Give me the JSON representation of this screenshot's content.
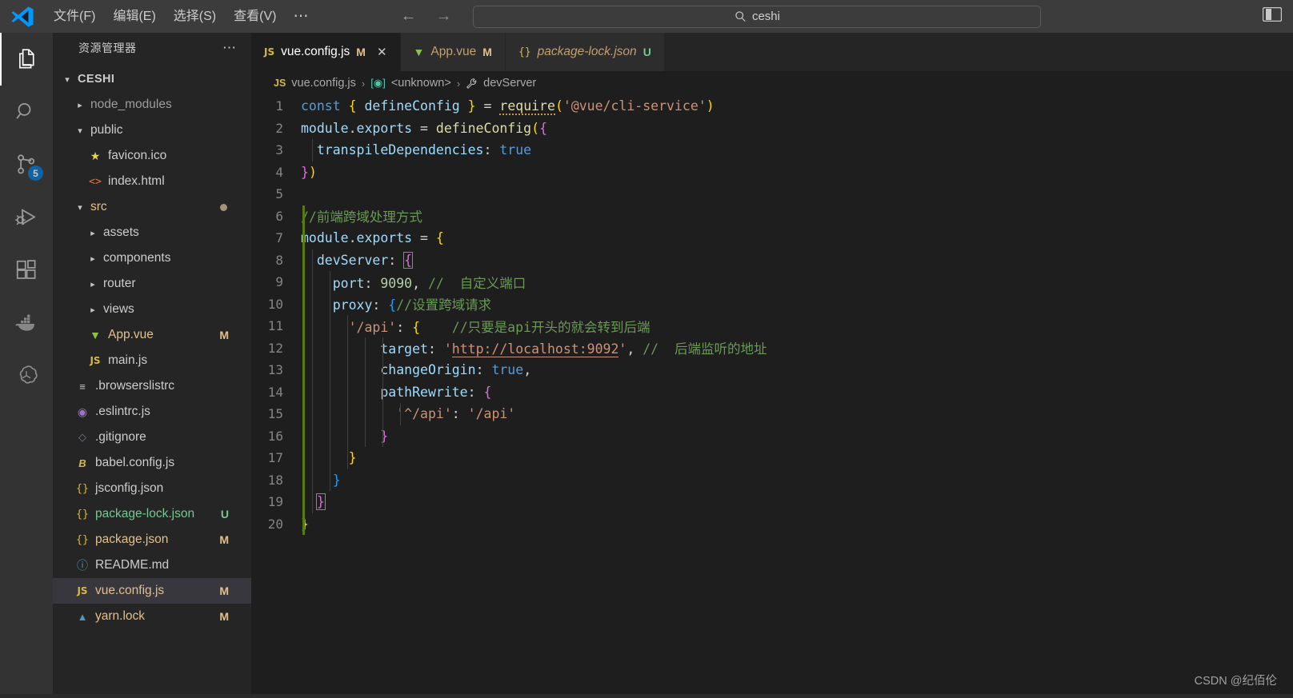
{
  "titlebar": {
    "logo_icon": "vscode-logo",
    "menus": [
      "文件(F)",
      "编辑(E)",
      "选择(S)",
      "查看(V)"
    ],
    "more_label": "⋯",
    "nav_back_icon": "arrow-left-icon",
    "nav_forward_icon": "arrow-right-icon",
    "search_icon": "search-icon",
    "search_value": "ceshi",
    "layout_icon": "toggle-panel-icon"
  },
  "activitybar": {
    "items": [
      {
        "name": "explorer",
        "icon": "files-icon",
        "active": true,
        "badge": ""
      },
      {
        "name": "search",
        "icon": "search-icon",
        "active": false,
        "badge": ""
      },
      {
        "name": "source-control",
        "icon": "source-control-icon",
        "active": false,
        "badge": "5"
      },
      {
        "name": "run-and-debug",
        "icon": "run-debug-icon",
        "active": false,
        "badge": ""
      },
      {
        "name": "extensions",
        "icon": "extensions-icon",
        "active": false,
        "badge": ""
      },
      {
        "name": "docker",
        "icon": "docker-whale-icon",
        "active": false,
        "badge": ""
      },
      {
        "name": "openai",
        "icon": "openai-icon",
        "active": false,
        "badge": ""
      }
    ]
  },
  "sidebar": {
    "title": "资源管理器",
    "more_label": "⋯",
    "root": {
      "label": "CESHI",
      "expanded": true
    },
    "tree": [
      {
        "label": "node_modules",
        "type": "folder",
        "expanded": false,
        "indent": 1,
        "color": "dim",
        "badge": "",
        "dot": false
      },
      {
        "label": "public",
        "type": "folder",
        "expanded": true,
        "indent": 1,
        "color": "plain",
        "badge": "",
        "dot": false
      },
      {
        "label": "favicon.ico",
        "type": "file",
        "icon": "star-icon",
        "indent": 2,
        "color": "plain",
        "badge": "",
        "dot": false
      },
      {
        "label": "index.html",
        "type": "file",
        "icon": "html-icon",
        "indent": 2,
        "color": "plain",
        "badge": "",
        "dot": false
      },
      {
        "label": "src",
        "type": "folder",
        "expanded": true,
        "indent": 1,
        "color": "mod",
        "badge": "",
        "dot": true
      },
      {
        "label": "assets",
        "type": "folder",
        "expanded": false,
        "indent": 2,
        "color": "plain",
        "badge": "",
        "dot": false
      },
      {
        "label": "components",
        "type": "folder",
        "expanded": false,
        "indent": 2,
        "color": "plain",
        "badge": "",
        "dot": false
      },
      {
        "label": "router",
        "type": "folder",
        "expanded": false,
        "indent": 2,
        "color": "plain",
        "badge": "",
        "dot": false
      },
      {
        "label": "views",
        "type": "folder",
        "expanded": false,
        "indent": 2,
        "color": "plain",
        "badge": "",
        "dot": false
      },
      {
        "label": "App.vue",
        "type": "file",
        "icon": "vue-icon",
        "indent": 2,
        "color": "mod",
        "badge": "M",
        "dot": false
      },
      {
        "label": "main.js",
        "type": "file",
        "icon": "js-icon",
        "indent": 2,
        "color": "plain",
        "badge": "",
        "dot": false
      },
      {
        "label": ".browserslistrc",
        "type": "file",
        "icon": "list-icon",
        "indent": 1,
        "color": "plain",
        "badge": "",
        "dot": false
      },
      {
        "label": ".eslintrc.js",
        "type": "file",
        "icon": "eslint-icon",
        "indent": 1,
        "color": "plain",
        "badge": "",
        "dot": false
      },
      {
        "label": ".gitignore",
        "type": "file",
        "icon": "git-icon",
        "indent": 1,
        "color": "plain",
        "badge": "",
        "dot": false
      },
      {
        "label": "babel.config.js",
        "type": "file",
        "icon": "babel-icon",
        "indent": 1,
        "color": "plain",
        "badge": "",
        "dot": false
      },
      {
        "label": "jsconfig.json",
        "type": "file",
        "icon": "json-icon",
        "indent": 1,
        "color": "plain",
        "badge": "",
        "dot": false
      },
      {
        "label": "package-lock.json",
        "type": "file",
        "icon": "json-icon",
        "indent": 1,
        "color": "new",
        "badge": "U",
        "dot": false
      },
      {
        "label": "package.json",
        "type": "file",
        "icon": "json-icon",
        "indent": 1,
        "color": "mod",
        "badge": "M",
        "dot": false
      },
      {
        "label": "README.md",
        "type": "file",
        "icon": "info-icon",
        "indent": 1,
        "color": "plain",
        "badge": "",
        "dot": false
      },
      {
        "label": "vue.config.js",
        "type": "file",
        "icon": "js-icon",
        "indent": 1,
        "color": "mod",
        "badge": "M",
        "dot": false,
        "selected": true
      },
      {
        "label": "yarn.lock",
        "type": "file",
        "icon": "yarn-icon",
        "indent": 1,
        "color": "mod",
        "badge": "M",
        "dot": false
      }
    ]
  },
  "tabs": [
    {
      "name": "vue.config.js",
      "icon": "js-icon",
      "badge": "M",
      "active": true,
      "italic": false,
      "close_icon": "close-icon"
    },
    {
      "name": "App.vue",
      "icon": "vue-icon",
      "badge": "M",
      "active": false,
      "italic": false,
      "close_icon": ""
    },
    {
      "name": "package-lock.json",
      "icon": "json-icon",
      "badge": "U",
      "active": false,
      "italic": true,
      "close_icon": ""
    }
  ],
  "breadcrumb": {
    "file_icon": "js-icon",
    "file": "vue.config.js",
    "sep": "›",
    "scope_icon": "module-icon",
    "scope": "<unknown>",
    "symbol_icon": "wrench-icon",
    "symbol": "devServer"
  },
  "code": {
    "lines": [
      {
        "n": 1,
        "text": "const { defineConfig } = require('@vue/cli-service')"
      },
      {
        "n": 2,
        "text": "module.exports = defineConfig({"
      },
      {
        "n": 3,
        "text": "  transpileDependencies: true"
      },
      {
        "n": 4,
        "text": "})"
      },
      {
        "n": 5,
        "text": ""
      },
      {
        "n": 6,
        "text": "//前端跨域处理方式"
      },
      {
        "n": 7,
        "text": "module.exports = {"
      },
      {
        "n": 8,
        "text": "  devServer: {"
      },
      {
        "n": 9,
        "text": "    port: 9090, //  自定义端口"
      },
      {
        "n": 10,
        "text": "    proxy: {//设置跨域请求"
      },
      {
        "n": 11,
        "text": "      '/api': {    //只要是api开头的就会转到后端"
      },
      {
        "n": 12,
        "text": "          target: 'http://localhost:9092', //  后端监听的地址"
      },
      {
        "n": 13,
        "text": "          changeOrigin: true,"
      },
      {
        "n": 14,
        "text": "          pathRewrite: {"
      },
      {
        "n": 15,
        "text": "            '^/api': '/api'"
      },
      {
        "n": 16,
        "text": "          }"
      },
      {
        "n": 17,
        "text": "      }"
      },
      {
        "n": 18,
        "text": "    }"
      },
      {
        "n": 19,
        "text": "  }"
      },
      {
        "n": 20,
        "text": "}"
      }
    ]
  },
  "watermark": "CSDN @纪佰伦",
  "colors": {
    "titlebar_bg": "#3c3c3c",
    "activitybar_bg": "#333333",
    "sidebar_bg": "#252526",
    "editor_bg": "#1e1e1e",
    "accent_badge": "#0078d4",
    "modified": "#e2c08d",
    "untracked": "#73c991",
    "gutter_change": "#587c0c"
  }
}
